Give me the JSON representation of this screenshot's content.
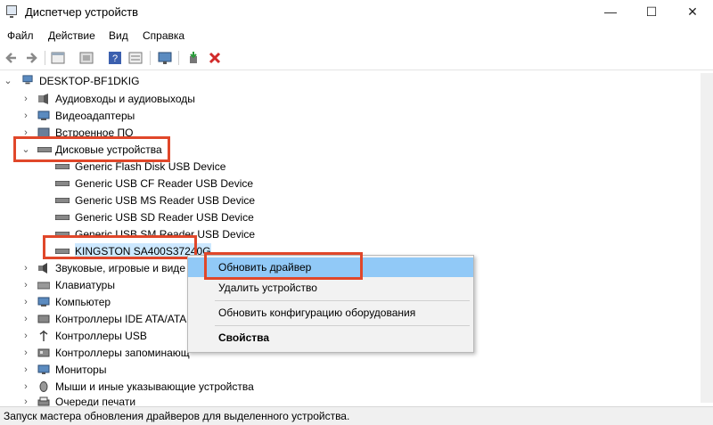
{
  "window": {
    "title": "Диспетчер устройств",
    "minimize": "—",
    "maximize": "☐",
    "close": "✕"
  },
  "menu": [
    "Файл",
    "Действие",
    "Вид",
    "Справка"
  ],
  "toolbar": [
    "back-arrow-icon",
    "forward-arrow-icon",
    "properties-icon",
    "update-driver-icon",
    "help-icon",
    "show-hidden-icon",
    "monitor-icon",
    "add-driver-icon",
    "uninstall-x-icon"
  ],
  "tree": {
    "root": "DESKTOP-BF1DKIG",
    "categories": [
      "Аудиовходы и аудиовыходы",
      "Видеоадаптеры",
      "Встроенное ПО",
      "Дисковые устройства"
    ],
    "disk_devices": [
      "Generic Flash Disk USB Device",
      "Generic USB CF Reader USB Device",
      "Generic USB MS Reader USB Device",
      "Generic USB SD Reader USB Device",
      "Generic USB SM Reader USB Device",
      "KINGSTON SA400S37240G"
    ],
    "more_categories": [
      "Звуковые, игровые и виде",
      "Клавиатуры",
      "Компьютер",
      "Контроллеры IDE ATA/ATA",
      "Контроллеры USB",
      "Контроллеры запоминающ",
      "Мониторы",
      "Мыши и иные указывающие устройства",
      "Очереди печати"
    ]
  },
  "context_menu": {
    "items": [
      "Обновить драйвер",
      "Удалить устройство",
      "Обновить конфигурацию оборудования",
      "Свойства"
    ],
    "selected": "Обновить драйвер"
  },
  "status": "Запуск мастера обновления драйверов для выделенного устройства.",
  "colors": {
    "highlight_border": "#e0472a",
    "menu_selected": "#91c9f7"
  }
}
